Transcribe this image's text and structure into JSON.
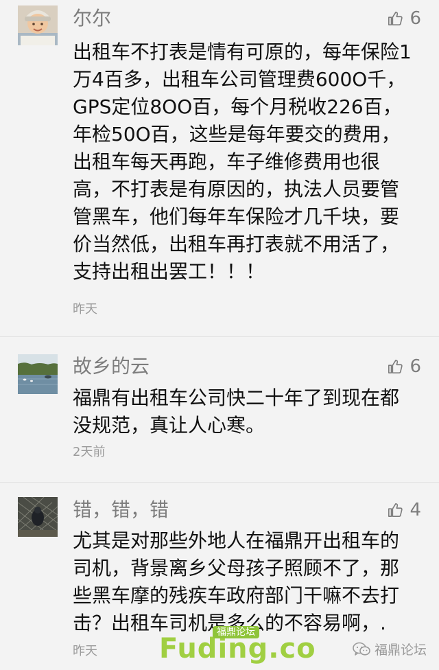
{
  "comments": [
    {
      "nickname": "尔尔",
      "likes": "6",
      "lines": [
        "出租车不打表是情有可原的，每年保险1",
        "万4百多，出租车公司管理费600O千，",
        "GPS定位8OO百，每个月税收226百，",
        "年检50O百，这些是每年要交的费用，",
        "出租车每天再跑，车子维修费用也很",
        "高，不打表是有原因的，执法人员要管",
        "管黑车，他们每年车保险才几千块，要",
        "价当然低，出租车再打表就不用活了，",
        "支持出租出罢工！！！"
      ],
      "time": "昨天"
    },
    {
      "nickname": "故乡的云",
      "likes": "6",
      "lines": [
        "福鼎有出租车公司快二十年了到现在都",
        "没规范，真让人心寒。"
      ],
      "time": "2天前"
    },
    {
      "nickname": "错，错，错",
      "likes": "4",
      "lines": [
        "尤其是对那些外地人在福鼎开出租车的",
        "司机，背景离乡父母孩子照顾不了，那",
        "些黑车摩的残疾车政府部门干嘛不去打",
        "击？出租车司机是多么的不容易啊，."
      ],
      "time": "昨天"
    }
  ],
  "watermark": {
    "brand": "Fuding.co",
    "tag": "福鼎论坛"
  },
  "wechat_mark": {
    "label": "福鼎论坛",
    "icon": "wechat-icon"
  },
  "colors": {
    "background": "#f3f3f3",
    "nickname": "#7d7d7d",
    "content": "#111111",
    "time": "#9a9a9a",
    "watermark": "#99cc33"
  }
}
